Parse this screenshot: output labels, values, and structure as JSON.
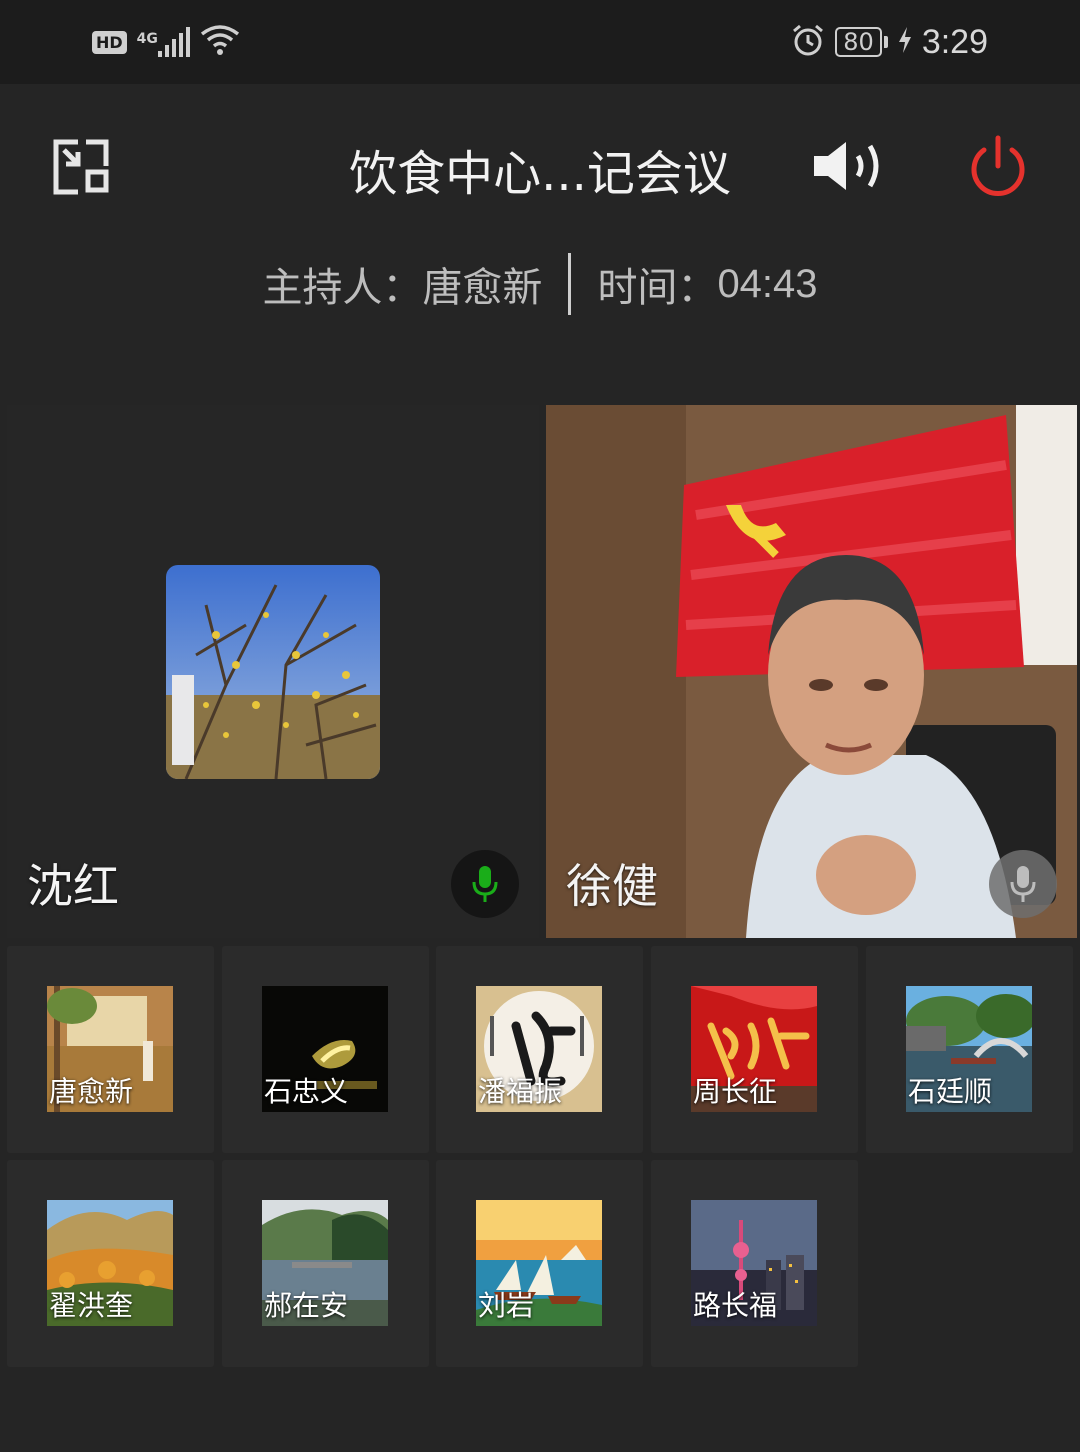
{
  "status_bar": {
    "hd": "HD",
    "network": "4G",
    "battery": "80",
    "time": "3:29"
  },
  "header": {
    "title": "饮食中心...记会议",
    "host_label": "主持人：",
    "host_name": "唐愈新",
    "time_label": "时间：",
    "duration": "04:43"
  },
  "main_tiles": [
    {
      "name": "沈红",
      "mic": "on"
    },
    {
      "name": "徐健",
      "mic": "off"
    }
  ],
  "participants": [
    {
      "name": "唐愈新"
    },
    {
      "name": "石忠义"
    },
    {
      "name": "潘福振"
    },
    {
      "name": "周长征"
    },
    {
      "name": "石廷顺"
    },
    {
      "name": "翟洪奎"
    },
    {
      "name": "郝在安"
    },
    {
      "name": "刘岩"
    },
    {
      "name": "路长福"
    }
  ],
  "colors": {
    "background": "#252525",
    "status_bar": "#1c1c1c",
    "power": "#e5322d",
    "mic_active": "#1aad19",
    "cell": "#2b2b2b"
  }
}
